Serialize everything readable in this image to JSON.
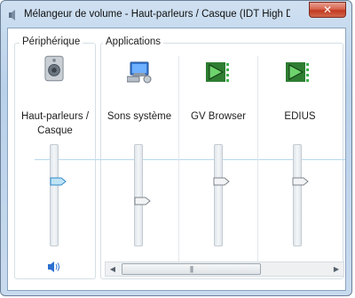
{
  "window": {
    "title": "Mélangeur de volume - Haut-parleurs / Casque (IDT High Definition...",
    "close_glyph": "✕"
  },
  "groups": {
    "device_label": "Périphérique",
    "apps_label": "Applications"
  },
  "channels": [
    {
      "label": "Haut-parleurs / Casque",
      "icon": "speaker-device-icon",
      "level": 0.62,
      "thumb_style": "selected-blue"
    },
    {
      "label": "Sons système",
      "icon": "system-sounds-icon",
      "level": 0.4,
      "thumb_style": "normal"
    },
    {
      "label": "GV Browser",
      "icon": "gv-browser-app-icon",
      "level": 0.62,
      "thumb_style": "normal"
    },
    {
      "label": "EDIUS",
      "icon": "edius-app-icon",
      "level": 0.62,
      "thumb_style": "normal"
    }
  ],
  "scrollbar": {
    "thumb_glyph": "|||"
  },
  "colors": {
    "accent": "#3c8fd6",
    "app_icon_green": "#2fb14a"
  }
}
